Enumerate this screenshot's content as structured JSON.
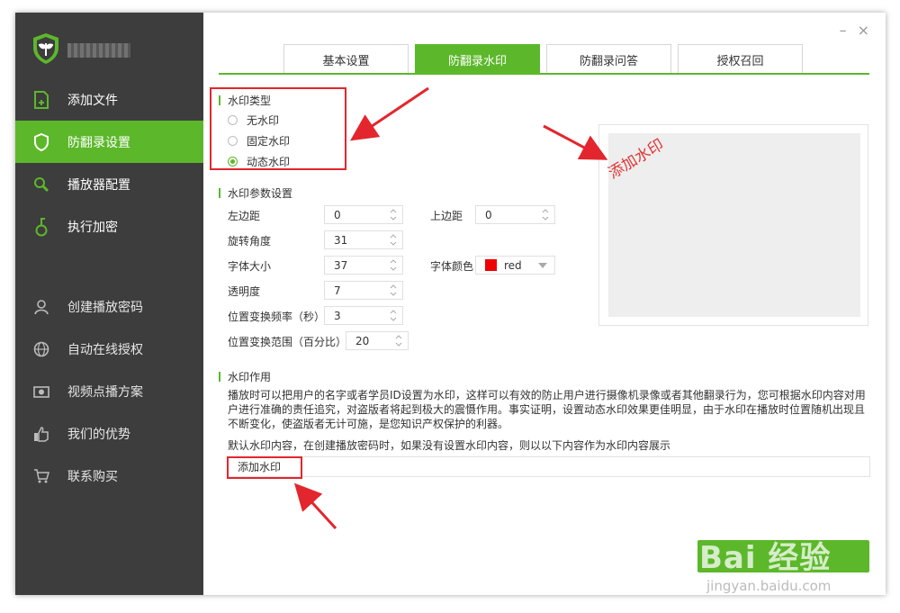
{
  "app": {
    "logo_icon": "shield-logo-icon",
    "username_blurred": true
  },
  "window_controls": {
    "minimize": "–",
    "close": "×"
  },
  "sidebar": {
    "items": [
      {
        "label": "添加文件",
        "icon": "add-file-icon"
      },
      {
        "label": "防翻录设置",
        "icon": "shield-icon",
        "active": true
      },
      {
        "label": "播放器配置",
        "icon": "search-icon"
      },
      {
        "label": "执行加密",
        "icon": "lock-icon"
      },
      {
        "label": "创建播放密码",
        "icon": "user-icon"
      },
      {
        "label": "自动在线授权",
        "icon": "globe-icon"
      },
      {
        "label": "视频点播方案",
        "icon": "camera-icon"
      },
      {
        "label": "我们的优势",
        "icon": "thumbs-up-icon"
      },
      {
        "label": "联系购买",
        "icon": "cart-icon"
      }
    ]
  },
  "tabs": [
    {
      "label": "基本设置"
    },
    {
      "label": "防翻录水印",
      "active": true
    },
    {
      "label": "防翻录问答"
    },
    {
      "label": "授权召回"
    }
  ],
  "watermark_type": {
    "title": "水印类型",
    "options": [
      {
        "label": "无水印",
        "selected": false
      },
      {
        "label": "固定水印",
        "selected": false
      },
      {
        "label": "动态水印",
        "selected": true
      }
    ]
  },
  "params": {
    "title": "水印参数设置",
    "left_margin": {
      "label": "左边距",
      "value": "0"
    },
    "top_margin": {
      "label": "上边距",
      "value": "0"
    },
    "rotation": {
      "label": "旋转角度",
      "value": "31"
    },
    "font_size": {
      "label": "字体大小",
      "value": "37"
    },
    "font_color": {
      "label": "字体颜色",
      "value": "red",
      "swatch": "#ee0000"
    },
    "opacity": {
      "label": "透明度",
      "value": "7"
    },
    "freq": {
      "label": "位置变换频率（秒）",
      "value": "3"
    },
    "range": {
      "label": "位置变换范围（百分比）",
      "value": "20"
    }
  },
  "preview": {
    "text": "添加水印",
    "color": "#e33333"
  },
  "effect": {
    "title": "水印作用",
    "description": "播放时可以把用户的名字或者学员ID设置为水印，这样可以有效的防止用户进行摄像机录像或者其他翻录行为，您可根据水印内容对用户进行准确的责任追究，对盗版者将起到极大的震慑作用。事实证明，设置动态水印效果更佳明显，由于水印在播放时位置随机出现且不断变化，使盗版者无计可施，是您知识产权保护的利器。",
    "default_note": "默认水印内容，在创建播放密码时，如果没有设置水印内容，则以以下内容作为水印内容展示",
    "input_value": "添加水印"
  },
  "watermark_overlay": {
    "brand": "Bai 经验",
    "sub": "jingyan.baidu.com"
  },
  "colors": {
    "accent": "#5cb82a",
    "sidebar_bg": "#3d3d3d",
    "annotation": "#e3262d"
  }
}
